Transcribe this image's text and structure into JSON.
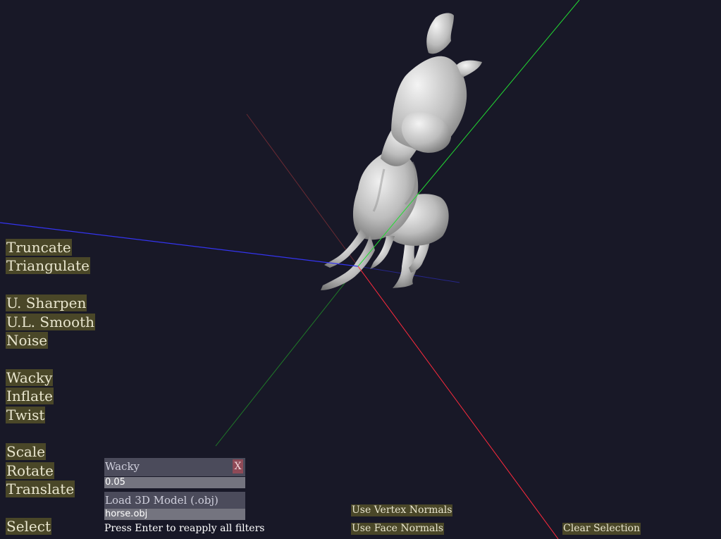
{
  "menu": [
    {
      "key": "truncate",
      "label": "Truncate"
    },
    {
      "key": "triangulate",
      "label": "Triangulate"
    },
    {
      "key": "sharpen",
      "label": "U. Sharpen"
    },
    {
      "key": "smooth",
      "label": "U.L. Smooth"
    },
    {
      "key": "noise",
      "label": "Noise"
    },
    {
      "key": "wacky",
      "label": "Wacky"
    },
    {
      "key": "inflate",
      "label": "Inflate"
    },
    {
      "key": "twist",
      "label": "Twist"
    },
    {
      "key": "scale",
      "label": "Scale"
    },
    {
      "key": "rotate",
      "label": "Rotate"
    },
    {
      "key": "translate",
      "label": "Translate"
    },
    {
      "key": "select",
      "label": "Select"
    }
  ],
  "filter_panel": {
    "title": "Wacky",
    "close_label": "X",
    "value": "0.05"
  },
  "load_panel": {
    "title": "Load 3D Model (.obj)",
    "filename": "horse.obj"
  },
  "hint": "Press Enter to reapply all filters",
  "buttons": {
    "vertex_normals": "Use Vertex Normals",
    "face_normals": "Use Face Normals",
    "clear_selection": "Clear Selection"
  },
  "colors": {
    "background": "#181827",
    "button_bg": "#4a4728",
    "axis_x": "#ff2a3d",
    "axis_y": "#22cc33",
    "axis_z": "#3030ee",
    "model": "#b8b8b8"
  }
}
